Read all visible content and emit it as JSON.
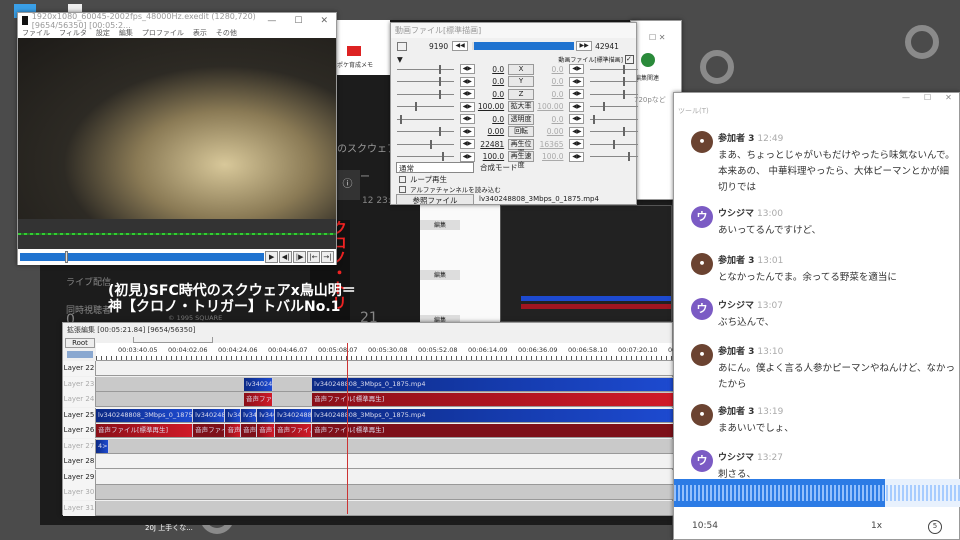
{
  "main_window": {
    "title": "1920x1080_60045-2002fps_48000Hz.exedit (1280,720)  [9654/56350] [00:05:2...",
    "menu": [
      "ファイル",
      "フィルタ",
      "設定",
      "編集",
      "プロファイル",
      "表示",
      "その他"
    ],
    "controls": {
      "minimize": "—",
      "maximize": "☐",
      "close": "✕"
    }
  },
  "background_page": {
    "caption_line1": "(初見)SFC時代のスクウェアx鳥山明＝",
    "caption_line2": "神【クロノ・トリガー】トバルNo.1",
    "side_title": "クロノ・トリガ",
    "live_label": "ライブ配信",
    "viewers_label": "同時視聴者",
    "viewers_value": "0",
    "duration_value": "21",
    "copyright": "© 1995 SQUARE",
    "bg_title": "のスクウェア",
    "bg_sub": "ガー",
    "bg_date": "12 23:20",
    "bookmark": "ポケ育成メモ",
    "edit_buttons": [
      "編集",
      "編集",
      "編集",
      "編集"
    ],
    "taskbar_text": "20J 上手くな..."
  },
  "chrome_window": {
    "bookmark_folder": "編集関連",
    "more": "»"
  },
  "settings_dialog": {
    "title": "動画ファイル[標準描画]",
    "start_frame": "9190",
    "end_frame": "42941",
    "object_label": "動画ファイル[標準描画]",
    "progress": 1.0,
    "rows": [
      {
        "left": "0.0",
        "param": "X",
        "right": "0.0"
      },
      {
        "left": "0.0",
        "param": "Y",
        "right": "0.0"
      },
      {
        "left": "0.0",
        "param": "Z",
        "right": "0.0"
      },
      {
        "left": "100.00",
        "param": "拡大率",
        "right": "100.00"
      },
      {
        "left": "0.0",
        "param": "透明度",
        "right": "0.0"
      },
      {
        "left": "0.00",
        "param": "回転",
        "right": "0.00"
      },
      {
        "left": "22481",
        "param": "再生位置",
        "right": "16365"
      },
      {
        "left": "100.0",
        "param": "再生速度",
        "right": "100.0"
      }
    ],
    "blend_mode": "通常",
    "blend_label": "合成モード",
    "loop_label": "ループ再生",
    "alpha_label": "アルファチャンネルを読み込む",
    "ref_button": "参照ファイル",
    "file_name": "lv340248808_3Mbps_0_1875.mp4"
  },
  "timeline": {
    "title": "拡張編集 [00:05:21.84] [9654/56350]",
    "root": "Root",
    "ticks": [
      "00:03:40.05",
      "00:04:02.06",
      "00:04:24.06",
      "00:04:46.07",
      "00:05:08.07",
      "00:05:30.08",
      "00:05:52.08",
      "00:06:14.09",
      "00:06:36.09",
      "00:06:58.10",
      "00:07:20.10",
      "00:0"
    ],
    "layers": [
      {
        "name": "Layer 22",
        "on": true,
        "clips": []
      },
      {
        "name": "Layer 23",
        "on": false,
        "clips": [
          {
            "t": "lv340248",
            "c": "blue",
            "s": 0.256,
            "e": 0.306
          },
          {
            "t": "lv340248808_3Mbps_0_1875.mp4",
            "c": "blue",
            "s": 0.374,
            "e": 1
          }
        ]
      },
      {
        "name": "Layer 24",
        "on": false,
        "clips": [
          {
            "t": "音声ファイル",
            "c": "red",
            "s": 0.256,
            "e": 0.306
          },
          {
            "t": "音声ファイル[標準再生]",
            "c": "red",
            "s": 0.374,
            "e": 1
          }
        ]
      },
      {
        "name": "Layer 25",
        "on": true,
        "clips": [
          {
            "t": "lv340248808_3Mbps_0_1875.mp4",
            "c": "blue",
            "s": 0,
            "e": 0.168
          },
          {
            "t": "lv3402488",
            "c": "blue",
            "s": 0.168,
            "e": 0.224
          },
          {
            "t": "lv34",
            "c": "blue",
            "s": 0.224,
            "e": 0.251
          },
          {
            "t": "lv340",
            "c": "blue",
            "s": 0.251,
            "e": 0.279
          },
          {
            "t": "lv340",
            "c": "blue",
            "s": 0.279,
            "e": 0.31
          },
          {
            "t": "lv340248808",
            "c": "blue",
            "s": 0.31,
            "e": 0.374
          },
          {
            "t": "lv340248808_3Mbps_0_1875.mp4",
            "c": "blue",
            "s": 0.374,
            "e": 1
          }
        ]
      },
      {
        "name": "Layer 26",
        "on": true,
        "clips": [
          {
            "t": "音声ファイル[標準再生]",
            "c": "red",
            "s": 0,
            "e": 0.168
          },
          {
            "t": "音声ファイル",
            "c": "dred",
            "s": 0.168,
            "e": 0.224
          },
          {
            "t": "音声",
            "c": "red",
            "s": 0.224,
            "e": 0.251
          },
          {
            "t": "音声ファ",
            "c": "dred",
            "s": 0.251,
            "e": 0.279
          },
          {
            "t": "音声フ",
            "c": "red",
            "s": 0.279,
            "e": 0.31
          },
          {
            "t": "音声ファイル[",
            "c": "red",
            "s": 0.31,
            "e": 0.374
          },
          {
            "t": "音声ファイル[標準再生]",
            "c": "dred",
            "s": 0.374,
            "e": 1
          }
        ]
      },
      {
        "name": "Layer 27",
        "on": false,
        "clips": [
          {
            "t": "4>(",
            "c": "blue",
            "s": 0,
            "e": 0.022
          }
        ]
      },
      {
        "name": "Layer 28",
        "on": true,
        "clips": []
      },
      {
        "name": "Layer 29",
        "on": true,
        "clips": []
      },
      {
        "name": "Layer 30",
        "on": false,
        "clips": []
      },
      {
        "name": "Layer 31",
        "on": false,
        "clips": []
      }
    ]
  },
  "chat": {
    "header_title": "720pなど",
    "header_menu": "ツール(T)",
    "messages": [
      {
        "name": "参加者 3",
        "time": "12:49",
        "avatar": "bear",
        "text": "まあ、ちょっとじゃがいもだけやったら味気ないんで。本来あの、 中華料理やったら、大体ピーマンとかが細切りでは"
      },
      {
        "name": "ウシジマ",
        "time": "13:00",
        "avatar": "u",
        "initial": "ウ",
        "text": "あいってるんですけど、"
      },
      {
        "name": "参加者 3",
        "time": "13:01",
        "avatar": "bear",
        "text": "となかったんでま。余ってる野菜を適当に"
      },
      {
        "name": "ウシジマ",
        "time": "13:07",
        "avatar": "u",
        "initial": "ウ",
        "text": "ぶち込んで、"
      },
      {
        "name": "参加者 3",
        "time": "13:10",
        "avatar": "bear",
        "text": "あにん。僕よく言る人参かピーマンやねんけど、なかったから"
      },
      {
        "name": "参加者 3",
        "time": "13:19",
        "avatar": "bear",
        "text": "まあいいでしょ、"
      },
      {
        "name": "ウシジマ",
        "time": "13:27",
        "avatar": "u",
        "initial": "ウ",
        "text": "刺さる、"
      }
    ],
    "player": {
      "time": "10:54",
      "speed": "1x",
      "progress": 0.735,
      "replay_icon": "replay-5-icon"
    }
  }
}
